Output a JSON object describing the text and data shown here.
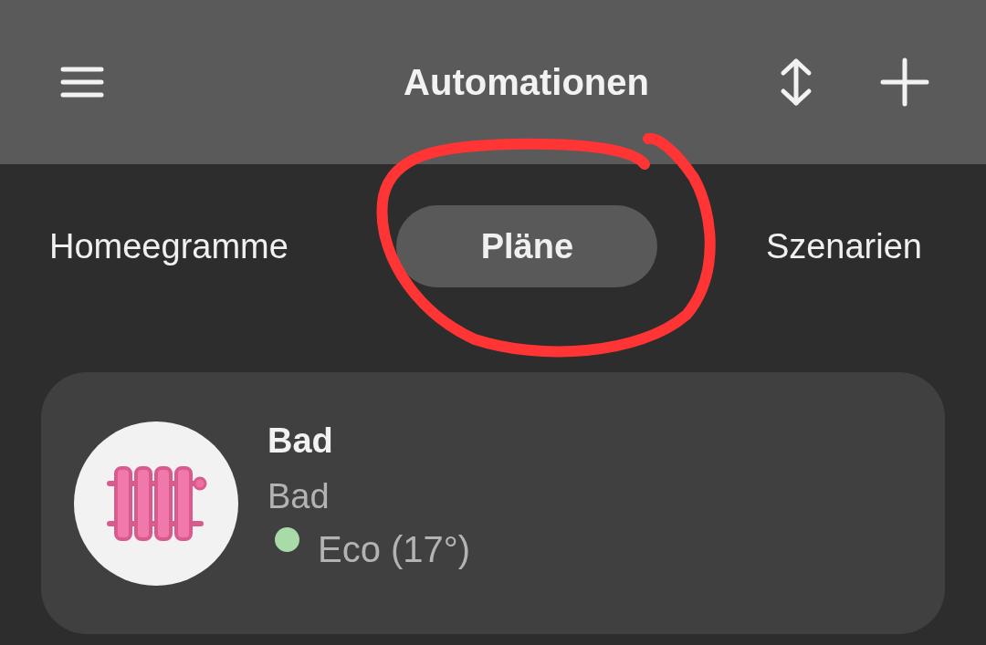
{
  "header": {
    "title": "Automationen"
  },
  "tabs": [
    {
      "label": "Homeegramme",
      "selected": false
    },
    {
      "label": "Pläne",
      "selected": true
    },
    {
      "label": "Szenarien",
      "selected": false
    }
  ],
  "plans": [
    {
      "name": "Bad",
      "room": "Bad",
      "status": "Eco (17°)",
      "color": "#a8dba8",
      "kind": "radiator"
    }
  ],
  "annotations": [
    {
      "kind": "freehand-circle"
    }
  ]
}
